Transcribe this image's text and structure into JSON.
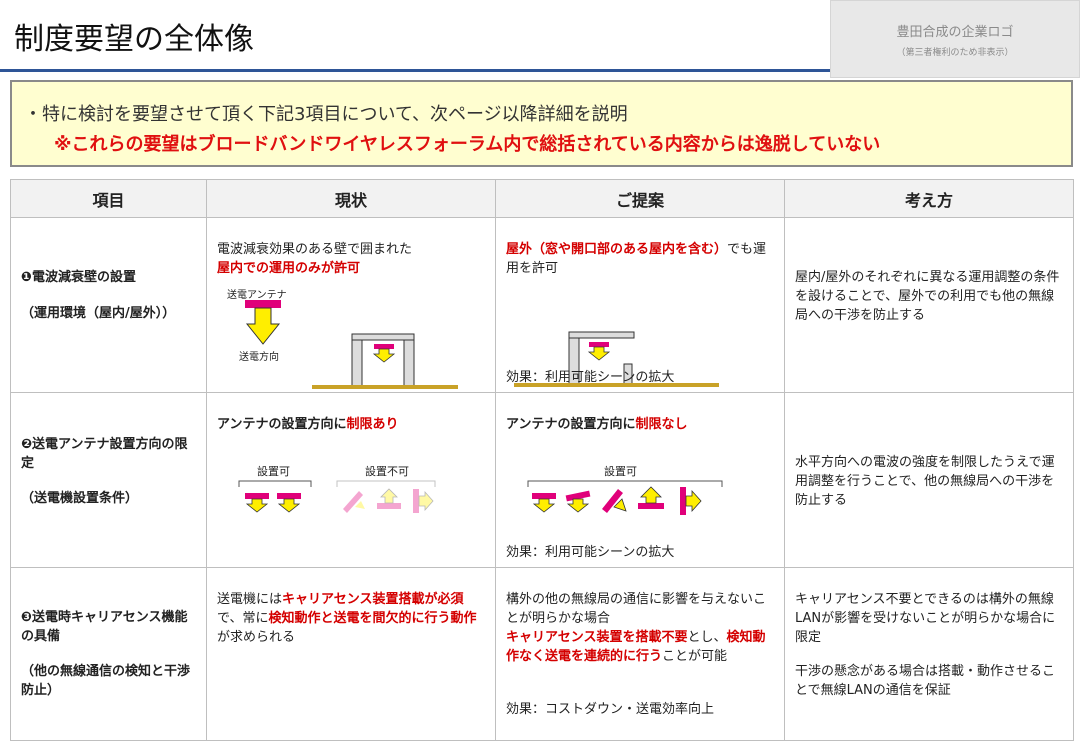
{
  "title": "制度要望の全体像",
  "logo": {
    "main": "豊田合成の企業ロゴ",
    "sub": "（第三者権利のため非表示）"
  },
  "summary": {
    "line1": "・特に検討を要望させて頂く下記3項目について、次ページ以降詳細を説明",
    "line2": "※これらの要望はブロードバンドワイヤレスフォーラム内で総括されている内容からは逸脱していない"
  },
  "table": {
    "headers": [
      "項目",
      "現状",
      "ご提案",
      "考え方"
    ],
    "rows": [
      {
        "item_title": "❶電波減衰壁の設置",
        "item_sub": "（運用環境（屋内/屋外））",
        "current": {
          "line1": "電波減衰効果のある壁で囲まれた",
          "line2_red": "屋内での運用のみが許可",
          "label_antenna": "送電アンテナ",
          "label_direction": "送電方向"
        },
        "proposal": {
          "red1": "屋外（窓や開口部のある屋内を含む）",
          "text1": "でも運用を許可",
          "effect": "効果：利用可能シーンの拡大"
        },
        "reason": "屋内/屋外のそれぞれに異なる運用調整の条件を設けることで、屋外での利用でも他の無線局への干渉を防止する"
      },
      {
        "item_title": "❷送電アンテナ設置方向の限定",
        "item_sub": "（送電機設置条件）",
        "current": {
          "head": "アンテナの設置方向に",
          "head_red": "制限あり",
          "label_ok": "設置可",
          "label_ng": "設置不可"
        },
        "proposal": {
          "head": "アンテナの設置方向に",
          "head_red": "制限なし",
          "label_ok": "設置可",
          "effect": "効果：利用可能シーンの拡大"
        },
        "reason": "水平方向への電波の強度を制限したうえで運用調整を行うことで、他の無線局への干渉を防止する"
      },
      {
        "item_title": "❸送電時キャリアセンス機能の具備",
        "item_sub": "（他の無線通信の検知と干渉防止）",
        "current": {
          "t1": "送電機には",
          "r1": "キャリアセンス装置搭載が必須",
          "t2": "で、常に",
          "r2": "検知動作と送電を間欠的に行う動作",
          "t3": "が求められる"
        },
        "proposal": {
          "t1": "構外の他の無線局の通信に影響を与えないことが明らかな場合",
          "r1": "キャリアセンス装置を搭載不要",
          "t2": "とし、",
          "r2": "検知動作なく送電を連続的に行う",
          "t3": "ことが可能",
          "effect": "効果：コストダウン・送電効率向上"
        },
        "reason1": "キャリアセンス不要とできるのは構外の無線LANが影響を受けないことが明らかな場合に限定",
        "reason2": "干渉の懸念がある場合は搭載・動作させることで無線LANの通信を保証"
      }
    ]
  },
  "colors": {
    "title_rule": "#2e5597",
    "summary_bg": "#fffed0",
    "red": "#d40000",
    "antenna": "#e0007a",
    "arrow": "#ffee00",
    "ground": "#c9a227"
  }
}
